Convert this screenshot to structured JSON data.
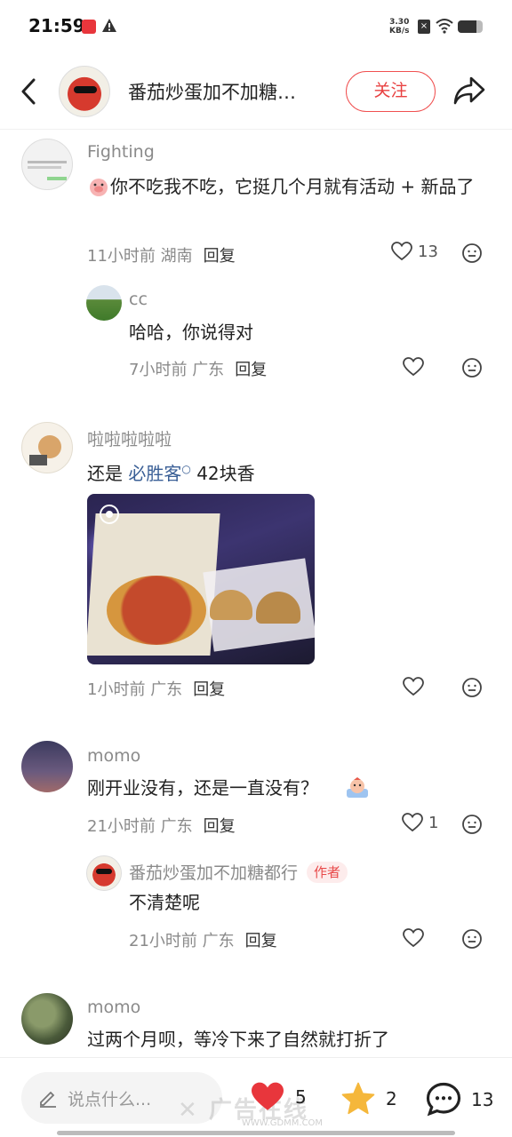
{
  "status_bar": {
    "time": "21:59",
    "net_speed_value": "3.30",
    "net_speed_unit": "KB/s",
    "battery_level": 0.75
  },
  "header": {
    "title": "番茄炒蛋加不加糖…",
    "follow_label": "关注"
  },
  "comments": [
    {
      "name": "Fighting",
      "text": "你不吃我不吃，它挺几个月就有活动 + 新品了",
      "time": "11小时前",
      "location": "湖南",
      "reply_label": "回复",
      "likes": "13",
      "replies": [
        {
          "name": "cc",
          "text": "哈哈，你说得对",
          "time": "7小时前",
          "location": "广东",
          "reply_label": "回复"
        }
      ]
    },
    {
      "name": "啦啦啦啦啦",
      "text_prefix": "还是 ",
      "text_link": "必胜客",
      "text_suffix": " 42块香",
      "time": "1小时前",
      "location": "广东",
      "reply_label": "回复"
    },
    {
      "name": "momo",
      "text": "刚开业没有，还是一直没有？",
      "time": "21小时前",
      "location": "广东",
      "reply_label": "回复",
      "likes": "1",
      "replies": [
        {
          "name": "番茄炒蛋加不加糖都行",
          "badge": "作者",
          "text": "不清楚呢",
          "time": "21小时前",
          "location": "广东",
          "reply_label": "回复"
        }
      ]
    },
    {
      "name": "momo",
      "text": "过两个月呗，等冷下来了自然就打折了"
    }
  ],
  "bottom_bar": {
    "input_placeholder": "说点什么...",
    "likes": "5",
    "stars": "2",
    "comments": "13"
  },
  "colors": {
    "accent": "#e84040",
    "link": "#3a5f96",
    "like_heart": "#e8363c",
    "star": "#f5b73b"
  }
}
